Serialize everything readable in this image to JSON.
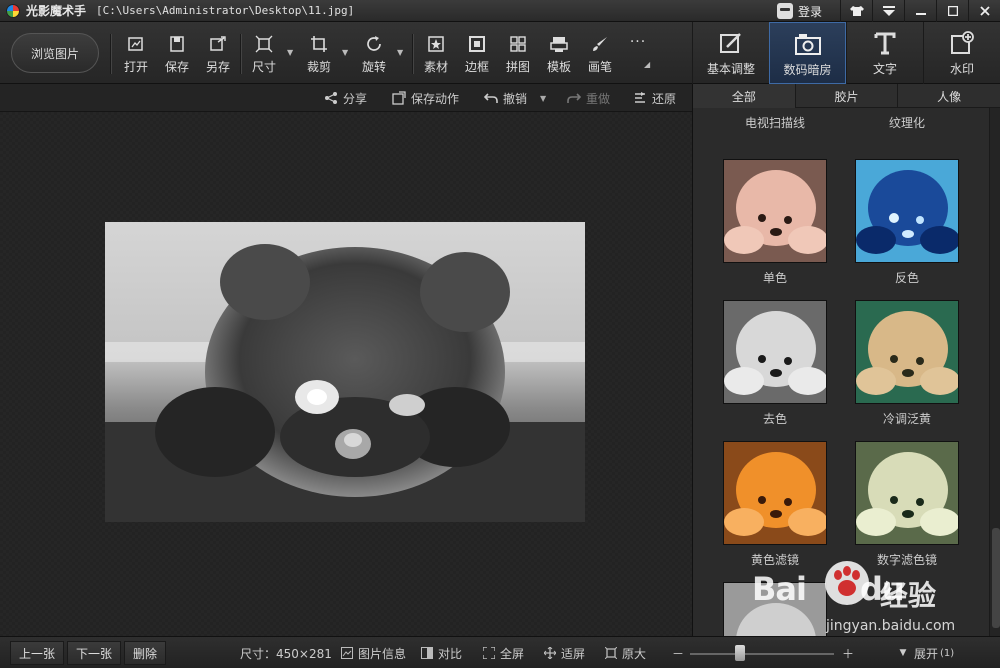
{
  "window": {
    "app_name": "光影魔术手",
    "file_path": "[C:\\Users\\Administrator\\Desktop\\11.jpg]",
    "login_label": "登录",
    "controls": [
      "skin-icon",
      "menu-icon",
      "minimize-icon",
      "maximize-icon",
      "close-icon"
    ]
  },
  "toolbar": {
    "browse_label": "浏览图片",
    "tools": [
      {
        "label": "打开",
        "icon": "open-icon"
      },
      {
        "label": "保存",
        "icon": "save-icon"
      },
      {
        "label": "另存",
        "icon": "save-as-icon"
      },
      {
        "label": "尺寸",
        "icon": "resize-icon"
      },
      {
        "label": "裁剪",
        "icon": "crop-icon"
      },
      {
        "label": "旋转",
        "icon": "rotate-icon"
      },
      {
        "label": "素材",
        "icon": "material-icon"
      },
      {
        "label": "边框",
        "icon": "border-icon"
      },
      {
        "label": "拼图",
        "icon": "collage-icon"
      },
      {
        "label": "模板",
        "icon": "template-icon"
      },
      {
        "label": "画笔",
        "icon": "brush-icon"
      }
    ],
    "more_label": "···"
  },
  "right_tabs": [
    {
      "label": "基本调整",
      "icon": "basic-adjust-icon",
      "active": false
    },
    {
      "label": "数码暗房",
      "icon": "darkroom-icon",
      "active": true
    },
    {
      "label": "文字",
      "icon": "text-icon",
      "active": false
    },
    {
      "label": "水印",
      "icon": "watermark-icon",
      "active": false
    }
  ],
  "actions": {
    "share": "分享",
    "save_action": "保存动作",
    "undo": "撤销",
    "redo": "重做",
    "restore": "还原"
  },
  "filter_categories": [
    {
      "label": "全部",
      "active": true
    },
    {
      "label": "胶片",
      "active": false
    },
    {
      "label": "人像",
      "active": false
    }
  ],
  "filters": [
    {
      "label": "电视扫描线"
    },
    {
      "label": "纹理化"
    },
    {
      "label": "单色"
    },
    {
      "label": "反色"
    },
    {
      "label": "去色"
    },
    {
      "label": "冷调泛黄"
    },
    {
      "label": "黄色滤镜"
    },
    {
      "label": "数字滤色镜"
    }
  ],
  "status": {
    "prev": "上一张",
    "next": "下一张",
    "delete": "删除",
    "size_label": "尺寸：450×281",
    "image_info": "图片信息",
    "compare": "对比",
    "fullscreen": "全屏",
    "fit": "适屏",
    "original": "原大",
    "zoom_minus": "－",
    "zoom_plus": "＋",
    "zoom_level": 0.35,
    "expand": "展开",
    "expand_count": "(1)"
  },
  "watermark": {
    "brand": "Bai",
    "brand_tail": "du",
    "cn": "经验",
    "url": "jingyan.baidu.com"
  },
  "colors": {
    "accent": "#3e6aa5",
    "background": "#1c1c1c",
    "panel": "#2b2b2b"
  }
}
